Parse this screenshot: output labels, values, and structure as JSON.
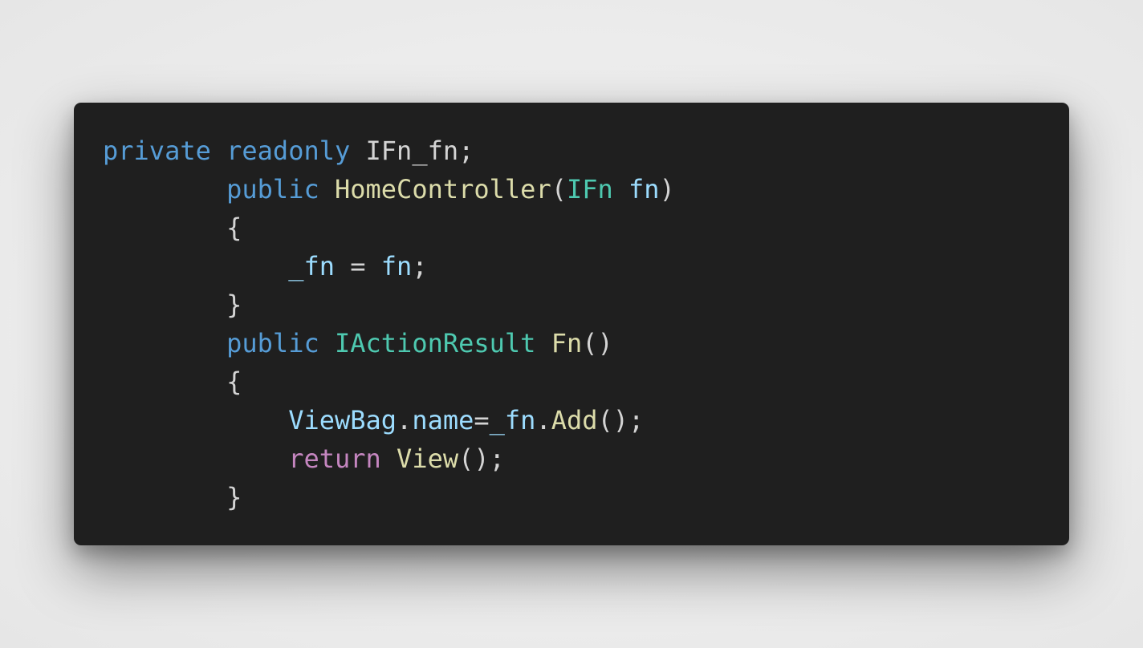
{
  "theme": {
    "page_background": "#ededed",
    "editor_background": "#1f1f1f",
    "colors": {
      "keyword": "#569cd6",
      "control": "#c586c0",
      "type": "#4ec9b0",
      "function": "#dcdcaa",
      "variable": "#9cdcfe",
      "punctuation": "#d4d4d4"
    }
  },
  "code": {
    "language": "C#",
    "lines": [
      [
        {
          "t": "keyword",
          "v": "private"
        },
        {
          "t": "plain",
          "v": " "
        },
        {
          "t": "keyword",
          "v": "readonly"
        },
        {
          "t": "plain",
          "v": " IFn_fn;"
        }
      ],
      [
        {
          "t": "plain",
          "v": "        "
        },
        {
          "t": "keyword",
          "v": "public"
        },
        {
          "t": "plain",
          "v": " "
        },
        {
          "t": "func",
          "v": "HomeController"
        },
        {
          "t": "punct",
          "v": "("
        },
        {
          "t": "type",
          "v": "IFn"
        },
        {
          "t": "plain",
          "v": " "
        },
        {
          "t": "var",
          "v": "fn"
        },
        {
          "t": "punct",
          "v": ")"
        }
      ],
      [
        {
          "t": "plain",
          "v": "        "
        },
        {
          "t": "punct",
          "v": "{"
        }
      ],
      [
        {
          "t": "plain",
          "v": "            "
        },
        {
          "t": "var",
          "v": "_fn"
        },
        {
          "t": "punct",
          "v": " = "
        },
        {
          "t": "var",
          "v": "fn"
        },
        {
          "t": "punct",
          "v": ";"
        }
      ],
      [
        {
          "t": "plain",
          "v": "        "
        },
        {
          "t": "punct",
          "v": "}"
        }
      ],
      [
        {
          "t": "plain",
          "v": "        "
        },
        {
          "t": "keyword",
          "v": "public"
        },
        {
          "t": "plain",
          "v": " "
        },
        {
          "t": "type",
          "v": "IActionResult"
        },
        {
          "t": "plain",
          "v": " "
        },
        {
          "t": "func",
          "v": "Fn"
        },
        {
          "t": "punct",
          "v": "()"
        }
      ],
      [
        {
          "t": "plain",
          "v": "        "
        },
        {
          "t": "punct",
          "v": "{"
        }
      ],
      [
        {
          "t": "plain",
          "v": "            "
        },
        {
          "t": "var",
          "v": "ViewBag"
        },
        {
          "t": "punct",
          "v": "."
        },
        {
          "t": "var",
          "v": "name"
        },
        {
          "t": "punct",
          "v": "="
        },
        {
          "t": "var",
          "v": "_fn"
        },
        {
          "t": "punct",
          "v": "."
        },
        {
          "t": "func",
          "v": "Add"
        },
        {
          "t": "punct",
          "v": "();"
        }
      ],
      [
        {
          "t": "plain",
          "v": "            "
        },
        {
          "t": "control",
          "v": "return"
        },
        {
          "t": "plain",
          "v": " "
        },
        {
          "t": "func",
          "v": "View"
        },
        {
          "t": "punct",
          "v": "();"
        }
      ],
      [
        {
          "t": "plain",
          "v": "        "
        },
        {
          "t": "punct",
          "v": "}"
        }
      ]
    ]
  }
}
